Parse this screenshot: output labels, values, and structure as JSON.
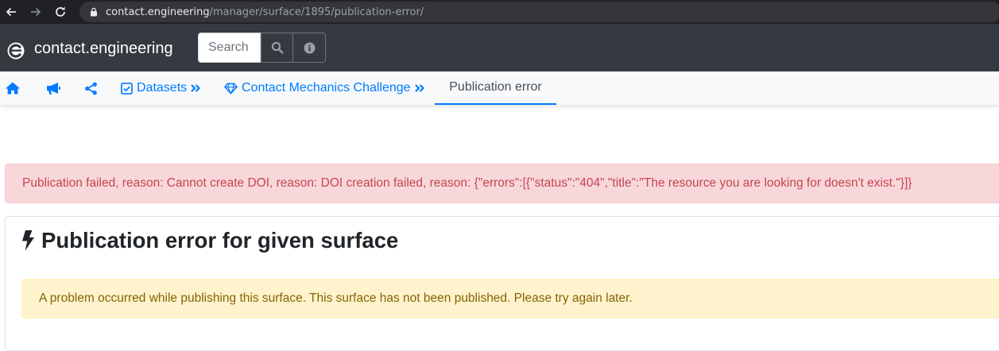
{
  "browser": {
    "url_host": "contact.engineering",
    "url_path": "/manager/surface/1895/publication-error/"
  },
  "navbar": {
    "brand": "contact.engineering",
    "search_placeholder": "Search",
    "icons": [
      "contact-engineering-logo-icon",
      "search-icon",
      "info-icon"
    ],
    "bg_color": "#343a40"
  },
  "tabs": [
    {
      "icon": "home-icon",
      "label": ""
    },
    {
      "icon": "bullhorn-icon",
      "label": ""
    },
    {
      "icon": "share-icon",
      "label": ""
    },
    {
      "icon": "checkbox-icon",
      "label": "Datasets"
    },
    {
      "icon": "diamond-icon",
      "label": "Contact Mechanics Challenge"
    },
    {
      "icon": "",
      "label": "Publication error",
      "active": true
    }
  ],
  "alerts": {
    "danger": "Publication failed, reason: Cannot create DOI, reason: DOI creation failed, reason: {\"errors\":[{\"status\":\"404\",\"title\":\"The resource you are looking for doesn't exist.\"}]}",
    "warning": "A problem occurred while publishing this surface. This surface has not been published. Please try again later."
  },
  "card": {
    "title": "Publication error for given surface",
    "icon": "bolt-icon"
  },
  "colors": {
    "link": "#007bff",
    "danger_bg": "#f8d7da",
    "warning_bg": "#fff3cd"
  }
}
